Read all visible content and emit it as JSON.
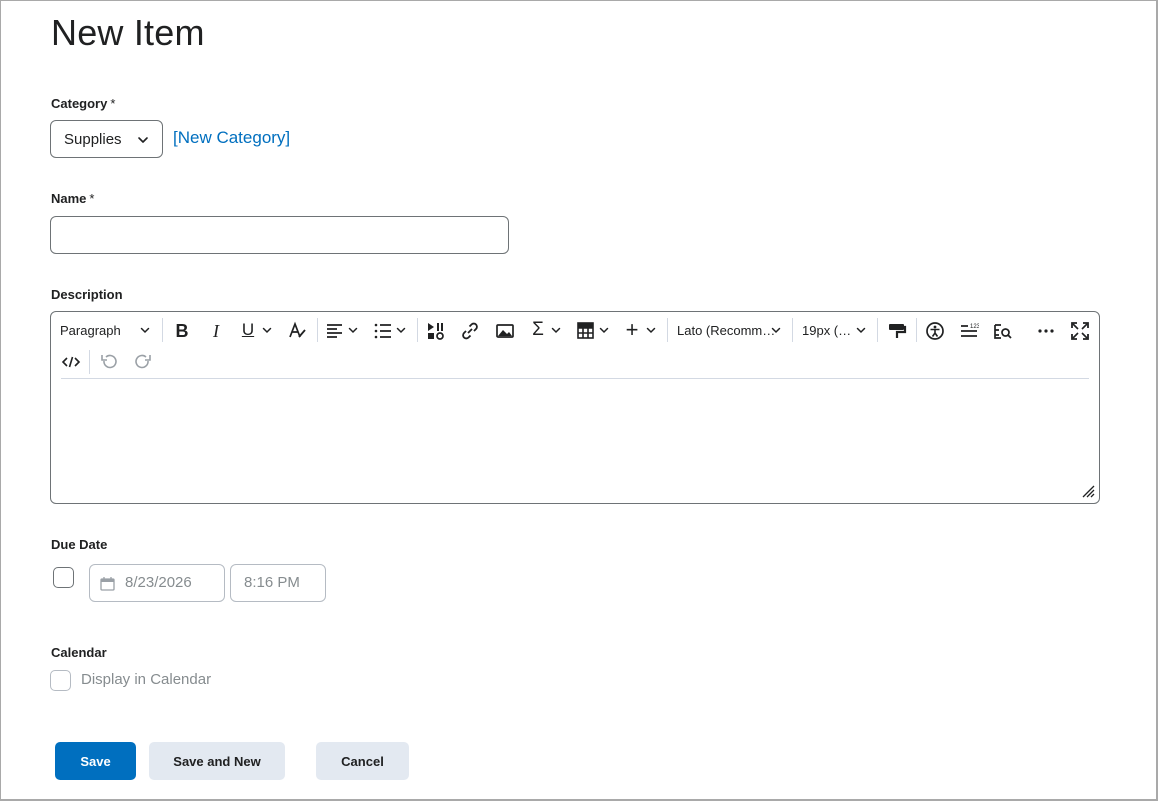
{
  "page": {
    "title": "New Item"
  },
  "category": {
    "label": "Category",
    "required_mark": "*",
    "selected": "Supplies",
    "new_link": "[New Category]"
  },
  "name": {
    "label": "Name",
    "required_mark": "*",
    "value": ""
  },
  "description": {
    "label": "Description",
    "toolbar": {
      "block_format": "Paragraph",
      "font_family": "Lato (Recomm…",
      "font_size": "19px (…"
    }
  },
  "due_date": {
    "label": "Due Date",
    "date": "8/23/2026",
    "time": "8:16 PM",
    "enabled": false
  },
  "calendar": {
    "label": "Calendar",
    "checkbox_label": "Display in Calendar",
    "checked": false
  },
  "actions": {
    "save": "Save",
    "save_and_new": "Save and New",
    "cancel": "Cancel"
  },
  "colors": {
    "accent": "#006fbf",
    "secondary_button": "#e3e9f1",
    "text": "#202122",
    "disabled_text": "#868c8f"
  }
}
